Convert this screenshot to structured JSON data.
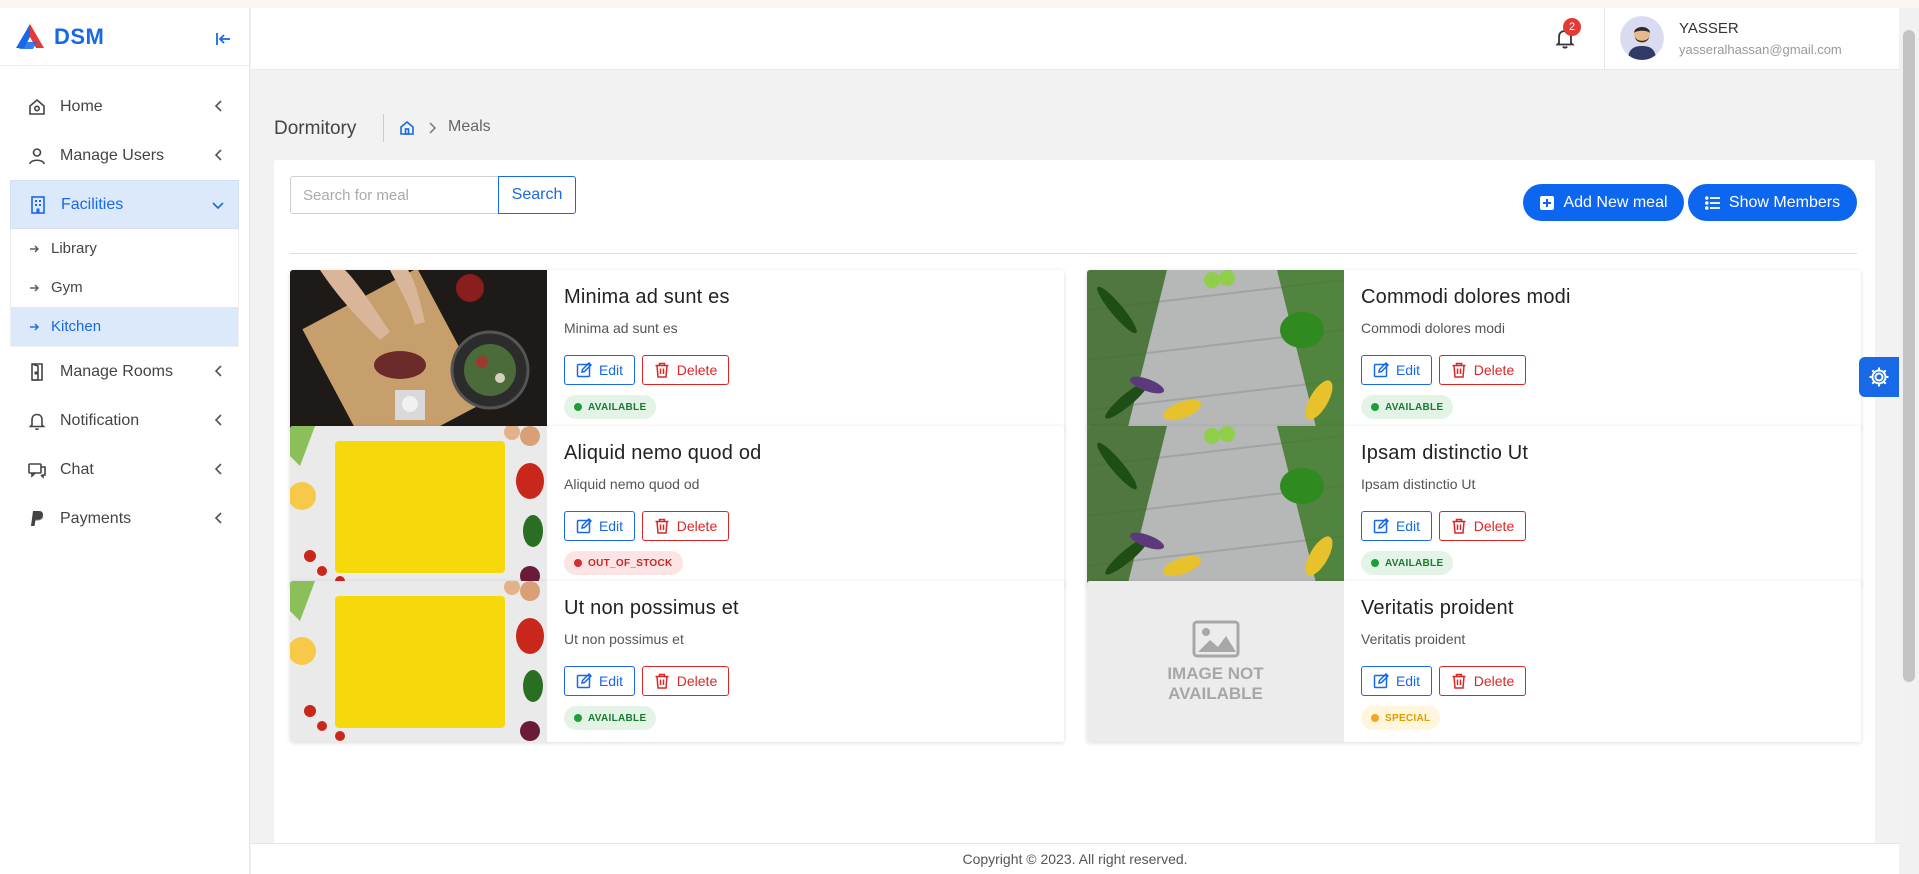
{
  "app": {
    "name": "DSM"
  },
  "sidebar": {
    "items": [
      {
        "label": "Home",
        "icon": "home-icon"
      },
      {
        "label": "Manage Users",
        "icon": "user-icon"
      },
      {
        "label": "Facilities",
        "icon": "building-icon",
        "expanded": true,
        "children": [
          {
            "label": "Library"
          },
          {
            "label": "Gym"
          },
          {
            "label": "Kitchen",
            "active": true
          }
        ]
      },
      {
        "label": "Manage Rooms",
        "icon": "door-icon"
      },
      {
        "label": "Notification",
        "icon": "bell-icon"
      },
      {
        "label": "Chat",
        "icon": "chat-icon"
      },
      {
        "label": "Payments",
        "icon": "paypal-icon"
      }
    ]
  },
  "header": {
    "notification_count": "2",
    "user_name": "YASSER",
    "user_email": "yasseralhassan@gmail.com"
  },
  "breadcrumb": {
    "title": "Dormitory",
    "current": "Meals"
  },
  "toolbar": {
    "search_placeholder": "Search for meal",
    "search_label": "Search",
    "add_label": "Add New meal",
    "members_label": "Show Members"
  },
  "actions": {
    "edit": "Edit",
    "delete": "Delete"
  },
  "placeholder_image": {
    "line1": "IMAGE NOT",
    "line2": "AVAILABLE"
  },
  "meals": [
    {
      "name": "Minima ad sunt es",
      "description": "Minima ad sunt es",
      "status": "AVAILABLE",
      "image": "cutting-board-photo"
    },
    {
      "name": "Commodi dolores modi",
      "description": "Commodi dolores modi",
      "status": "AVAILABLE",
      "image": "vegetables-wood-photo"
    },
    {
      "name": "Aliquid nemo quod od",
      "description": "Aliquid nemo quod od",
      "status": "OUT_OF_STOCK",
      "image": "yellow-board-photo"
    },
    {
      "name": "Ipsam distinctio Ut",
      "description": "Ipsam distinctio Ut",
      "status": "AVAILABLE",
      "image": "vegetables-wood-photo"
    },
    {
      "name": "Ut non possimus et",
      "description": "Ut non possimus et",
      "status": "AVAILABLE",
      "image": "yellow-board-photo"
    },
    {
      "name": "Veritatis proident",
      "description": "Veritatis proident",
      "status": "SPECIAL",
      "image": "image-not-available"
    }
  ],
  "footer": {
    "copyright": "Copyright © 2023. All right reserved."
  },
  "colors": {
    "primary": "#1769e8",
    "button": "#0d66f0",
    "danger": "#dc2626",
    "available": "#1f9d3a",
    "special": "#f5a623"
  }
}
